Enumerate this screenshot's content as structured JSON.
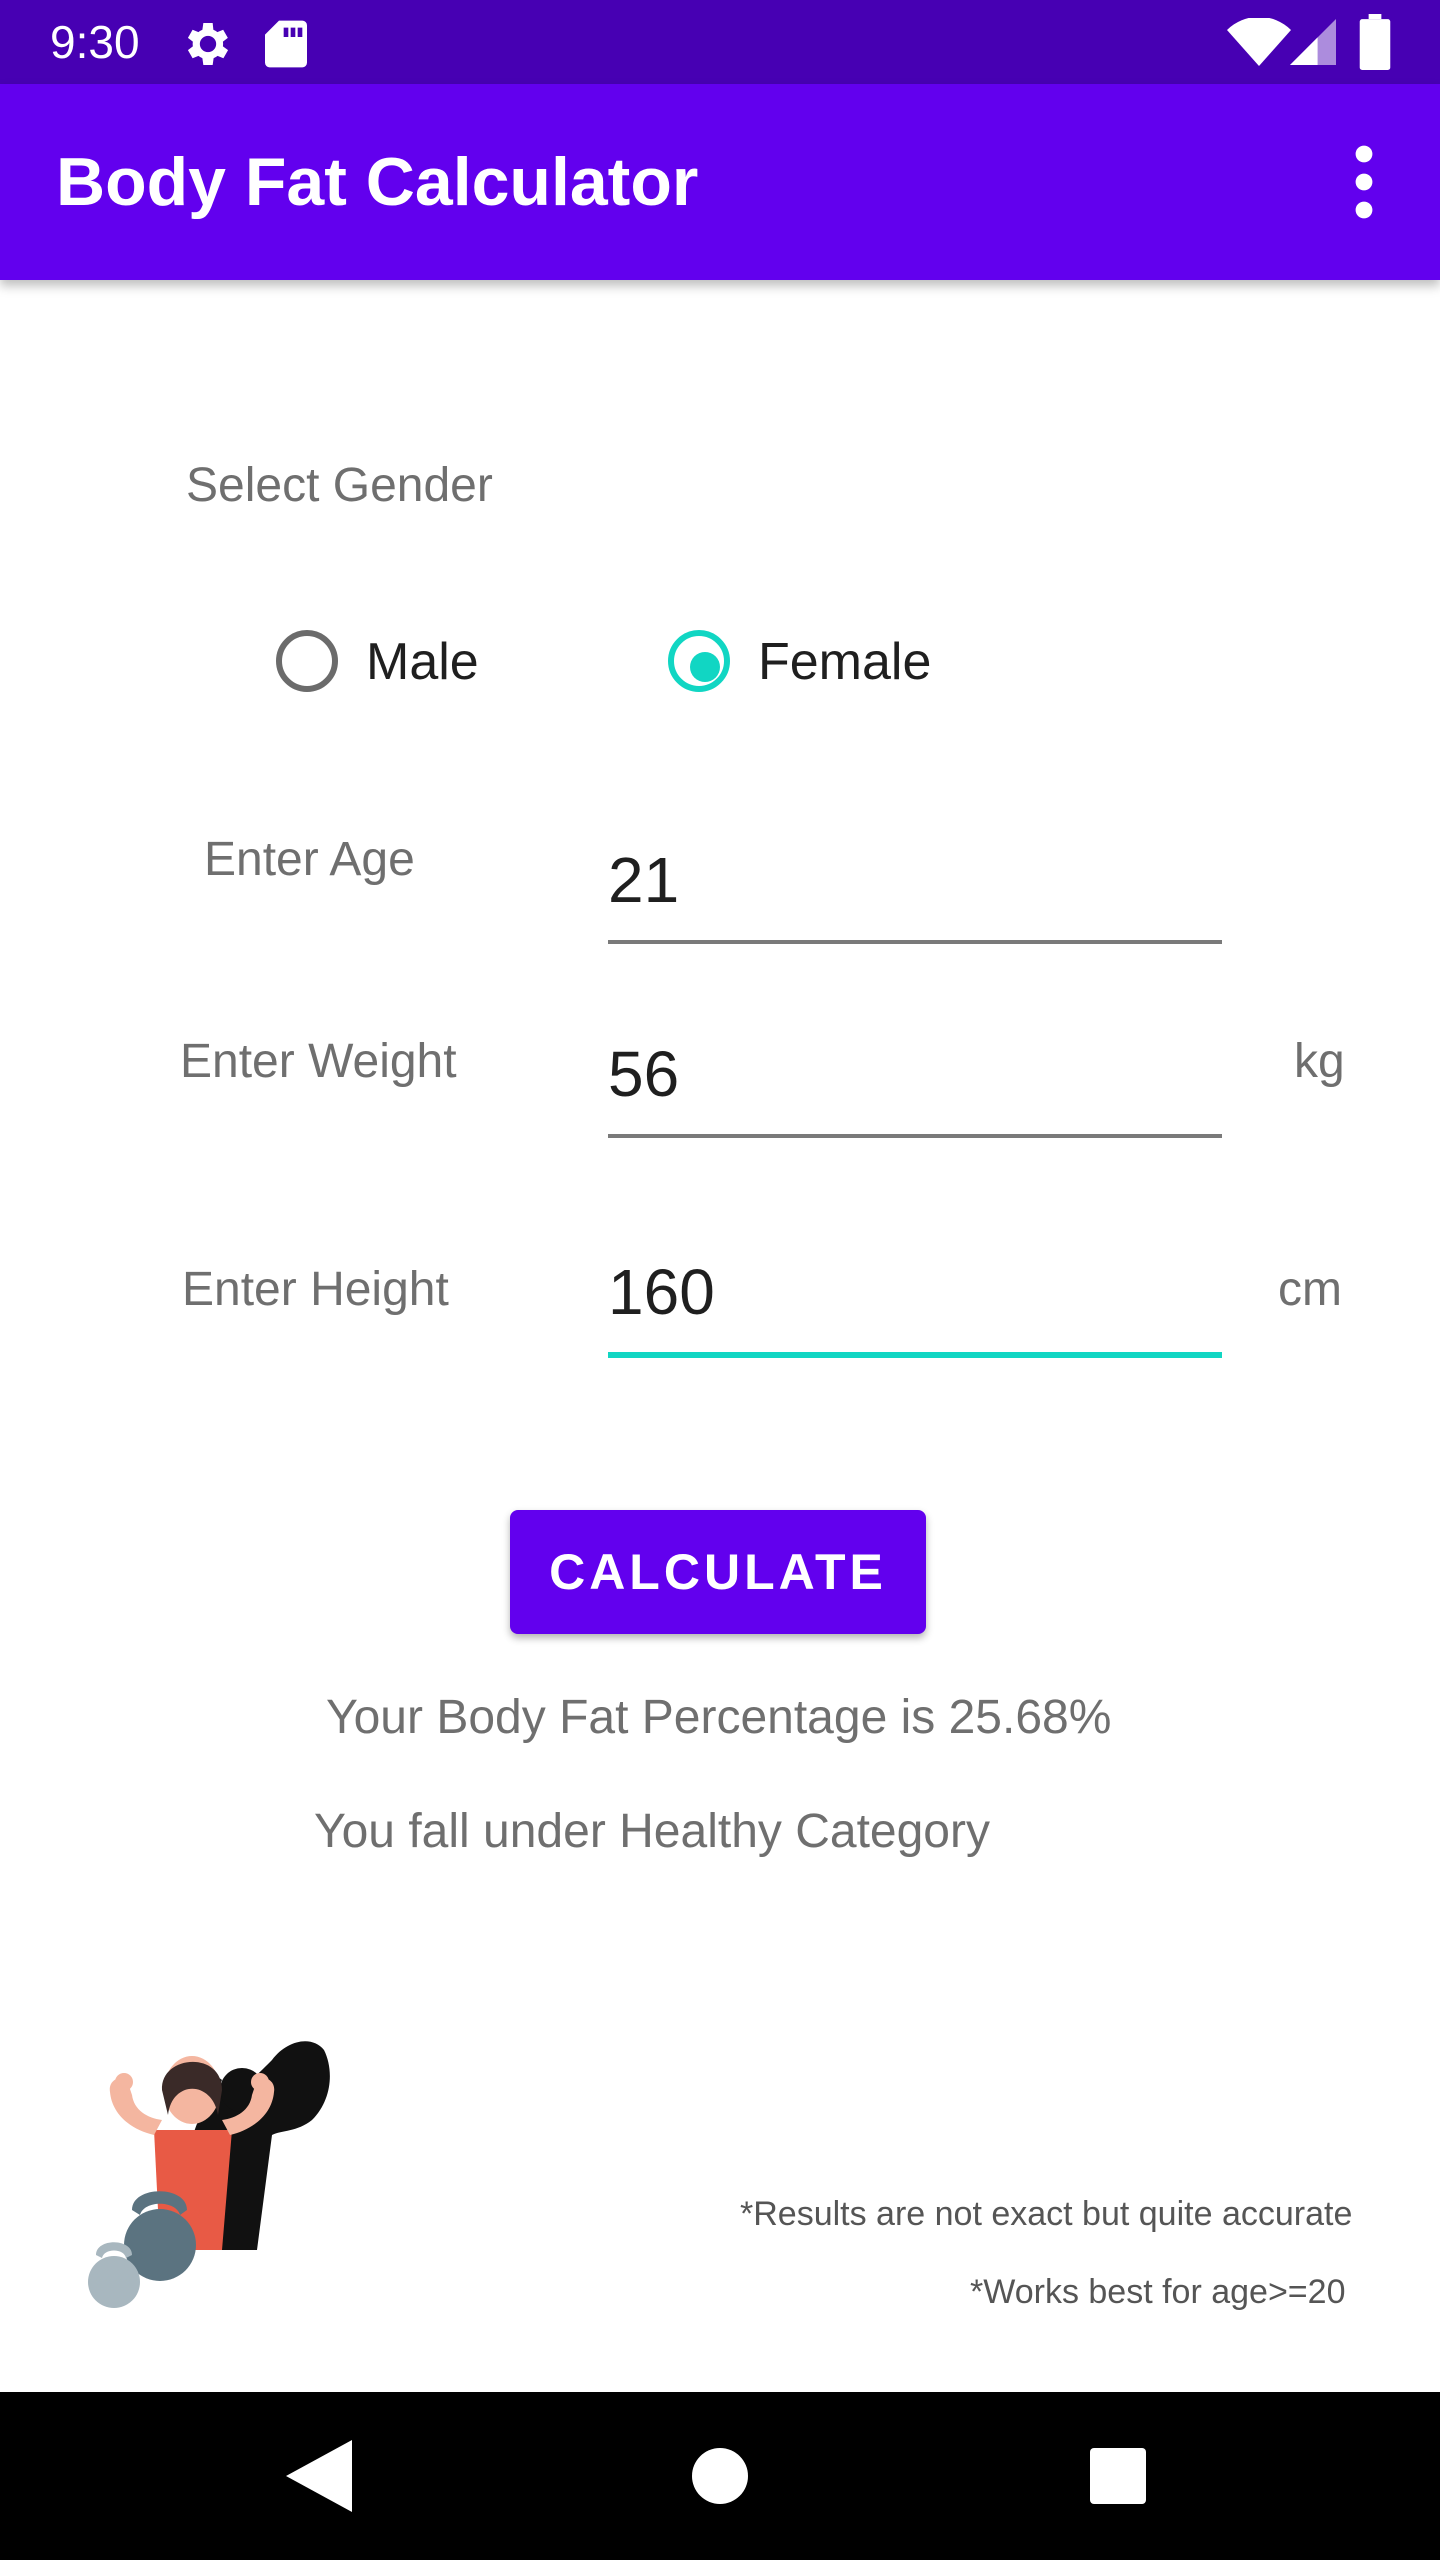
{
  "status_bar": {
    "time": "9:30",
    "icons": [
      "gear-icon",
      "sd-card-icon",
      "wifi-icon",
      "signal-icon",
      "battery-icon"
    ]
  },
  "app_bar": {
    "title": "Body Fat Calculator",
    "menu_icon": "overflow-menu-icon"
  },
  "gender": {
    "label": "Select Gender",
    "options": [
      {
        "label": "Male",
        "selected": false
      },
      {
        "label": "Female",
        "selected": true
      }
    ]
  },
  "form": {
    "age": {
      "label": "Enter Age",
      "value": "21"
    },
    "weight": {
      "label": "Enter Weight",
      "value": "56",
      "unit": "kg"
    },
    "height": {
      "label": "Enter Height",
      "value": "160",
      "unit": "cm"
    }
  },
  "calculate_label": "CALCULATE",
  "result": {
    "percentage_text": "Your Body Fat Percentage is 25.68%",
    "category_text": "You fall under Healthy Category"
  },
  "notes": {
    "accuracy": "*Results are not exact but quite accurate",
    "age": "*Works best for age>=20"
  },
  "colors": {
    "status_bar": "#4700b3",
    "app_bar": "#6200ee",
    "accent": "#11d6c3",
    "button": "#6200ee"
  },
  "nav_bar": {
    "icons": [
      "back-icon",
      "home-icon",
      "recent-apps-icon"
    ]
  }
}
